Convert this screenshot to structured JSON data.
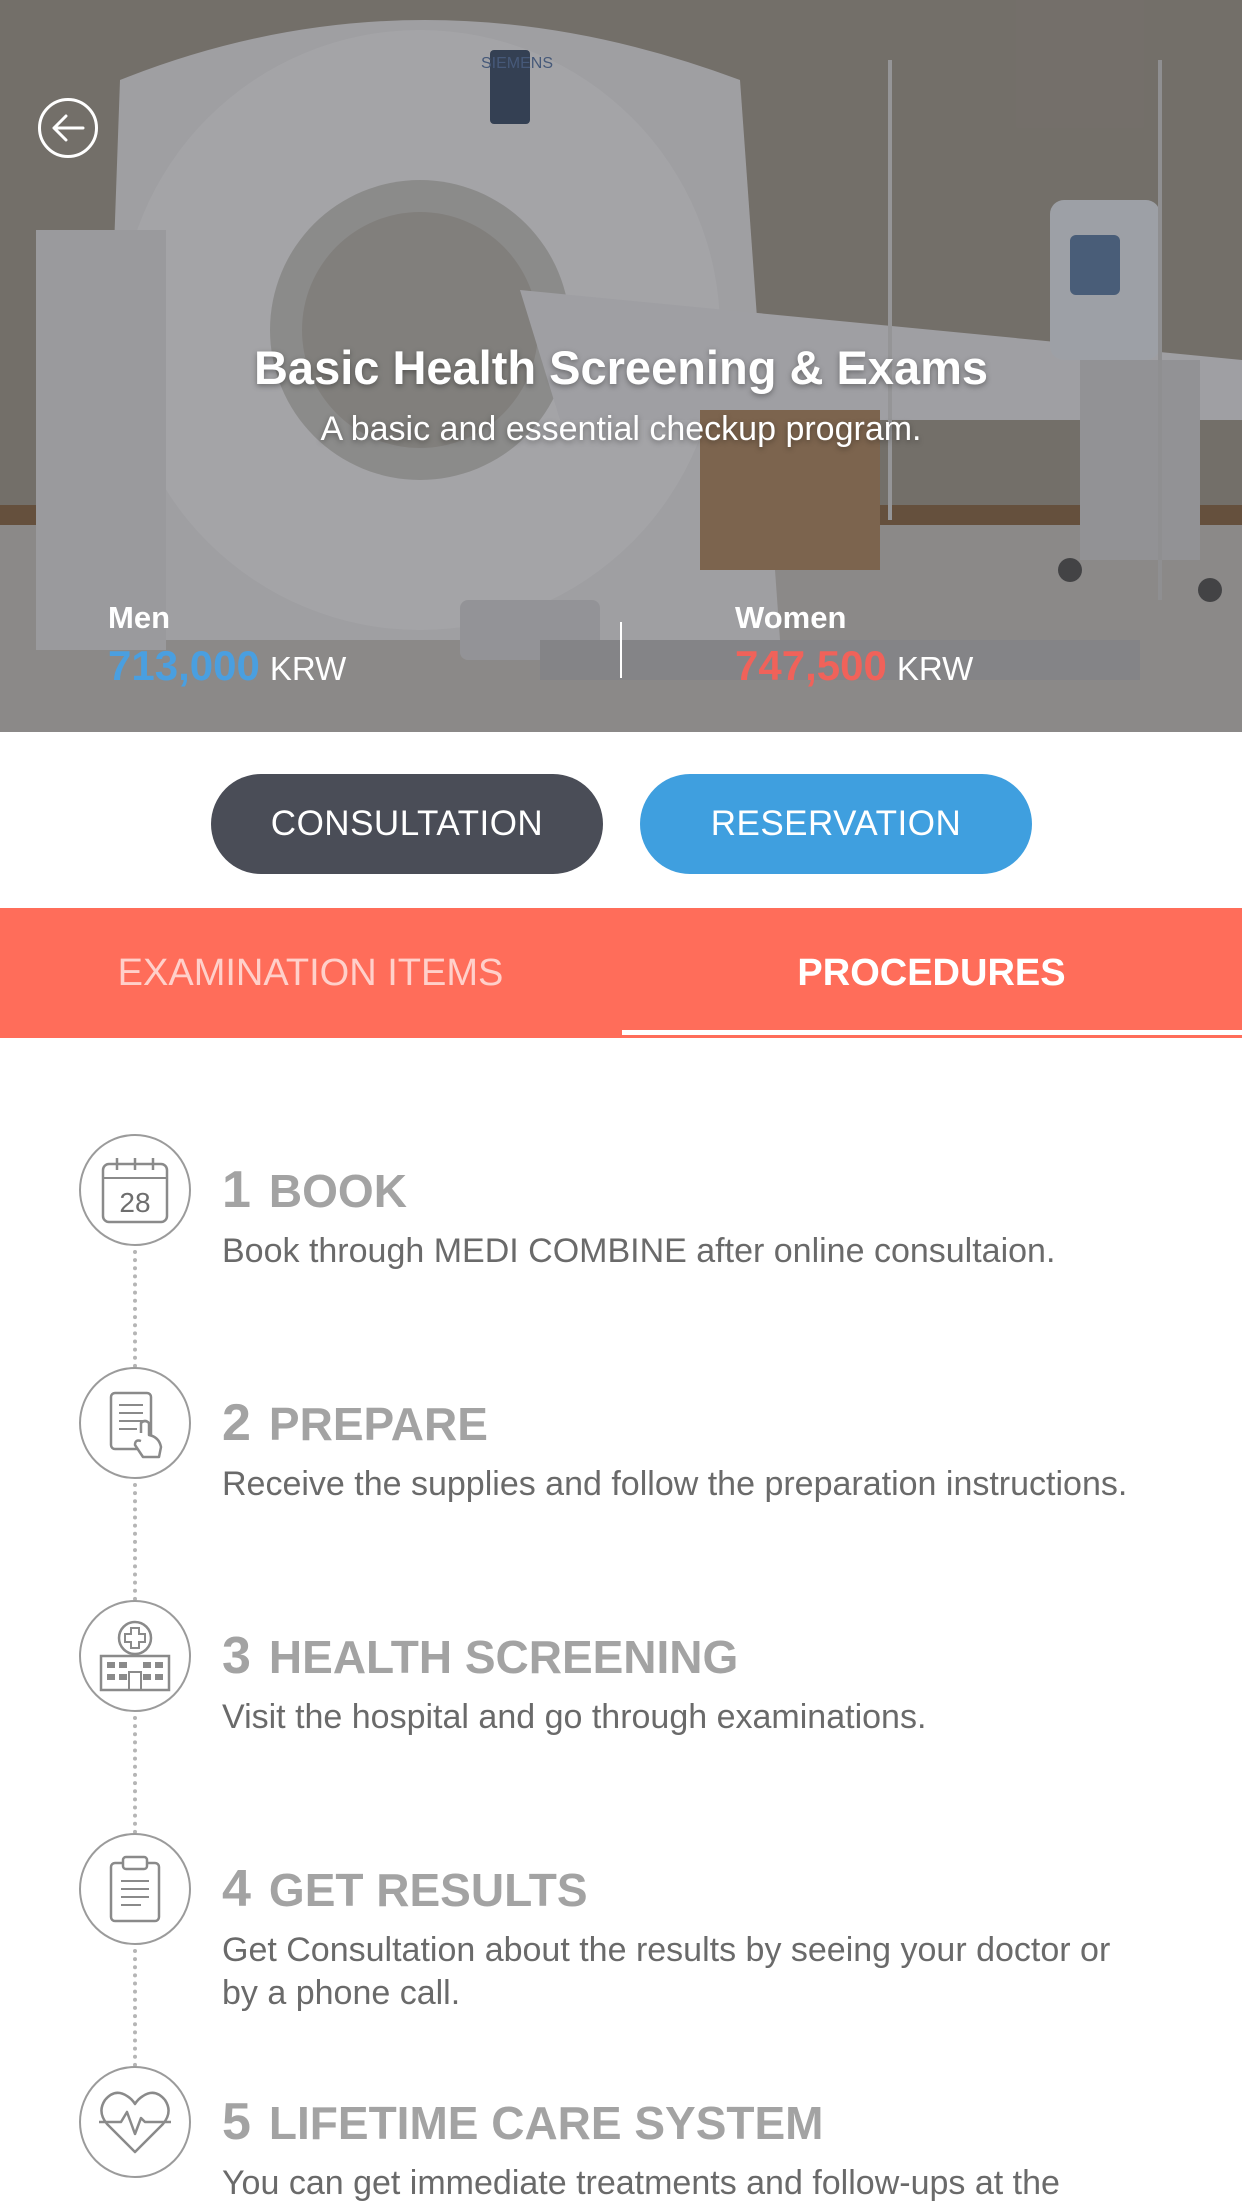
{
  "hero": {
    "title": "Basic Health Screening & Exams",
    "subtitle": "A basic and essential checkup program.",
    "scanner_brand": "SIEMENS",
    "men": {
      "label": "Men",
      "price": "713,000",
      "currency": "KRW",
      "color": "#4a9fe0"
    },
    "women": {
      "label": "Women",
      "price": "747,500",
      "currency": "KRW",
      "color": "#f0625a"
    }
  },
  "actions": {
    "consultation": "CONSULTATION",
    "reservation": "RESERVATION"
  },
  "tabs": {
    "items": "EXAMINATION ITEMS",
    "procedures": "PROCEDURES",
    "active": "PROCEDURES",
    "color": "#ff6d5a"
  },
  "steps": [
    {
      "num": "1",
      "title": "BOOK",
      "icon": "calendar-icon",
      "calendar_day": "28",
      "desc": "Book through MEDI COMBINE after online consultaion."
    },
    {
      "num": "2",
      "title": "PREPARE",
      "icon": "tablet-hand-icon",
      "desc": "Receive the supplies and follow the preparation instructions."
    },
    {
      "num": "3",
      "title": "HEALTH SCREENING",
      "icon": "hospital-icon",
      "desc": "Visit the hospital and go through examinations."
    },
    {
      "num": "4",
      "title": "GET RESULTS",
      "icon": "clipboard-icon",
      "desc": "Get Consultation about the results by seeing your doctor or by a phone call."
    },
    {
      "num": "5",
      "title": "LIFETIME CARE SYSTEM",
      "icon": "heartbeat-icon",
      "desc": "You can get immediate treatments and follow-ups at the related hospital."
    }
  ]
}
